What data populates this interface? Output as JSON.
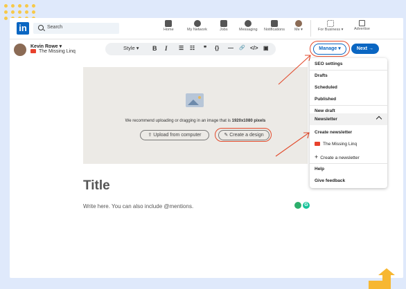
{
  "nav": {
    "logo": "in",
    "search_placeholder": "Search",
    "items": [
      {
        "label": "Home",
        "icon": "home-icon"
      },
      {
        "label": "My Network",
        "icon": "network-icon"
      },
      {
        "label": "Jobs",
        "icon": "briefcase-icon"
      },
      {
        "label": "Messaging",
        "icon": "chat-icon"
      },
      {
        "label": "Notifications",
        "icon": "bell-icon"
      },
      {
        "label": "Me",
        "icon": "profile-avatar"
      },
      {
        "label": "For Business",
        "icon": "grid-icon"
      },
      {
        "label": "Advertise",
        "icon": "advertise-icon"
      }
    ]
  },
  "author": {
    "name": "Kevin Rowe",
    "newsletter": "The Missing Linq"
  },
  "toolbar": {
    "style_label": "Style",
    "buttons": [
      "B",
      "I",
      "☰",
      "☷",
      "❞",
      "{}",
      "—",
      "🔗",
      "</>",
      "▣"
    ]
  },
  "actions": {
    "manage_label": "Manage",
    "next_label": "Next"
  },
  "cover": {
    "recommendation_prefix": "We recommend uploading or dragging in an image that is ",
    "recommendation_size": "1920x1080 pixels",
    "upload_label": "Upload from computer",
    "design_label": "Create a design"
  },
  "editor": {
    "title_placeholder": "Title",
    "body_placeholder": "Write here. You can also include @mentions."
  },
  "menu": {
    "items": {
      "seo": "SEO settings",
      "drafts": "Drafts",
      "scheduled": "Scheduled",
      "published": "Published",
      "new_draft": "New draft",
      "newsletter": "Newsletter",
      "create_newsletter": "Create newsletter",
      "missing_linq": "The Missing Linq",
      "create_a_newsletter": "Create a newsletter",
      "help": "Help",
      "feedback": "Give feedback"
    }
  },
  "colors": {
    "brand": "#0a66c2",
    "annotation": "#e24a2b",
    "background": "#dfe9fb",
    "accent": "#f7c948"
  }
}
